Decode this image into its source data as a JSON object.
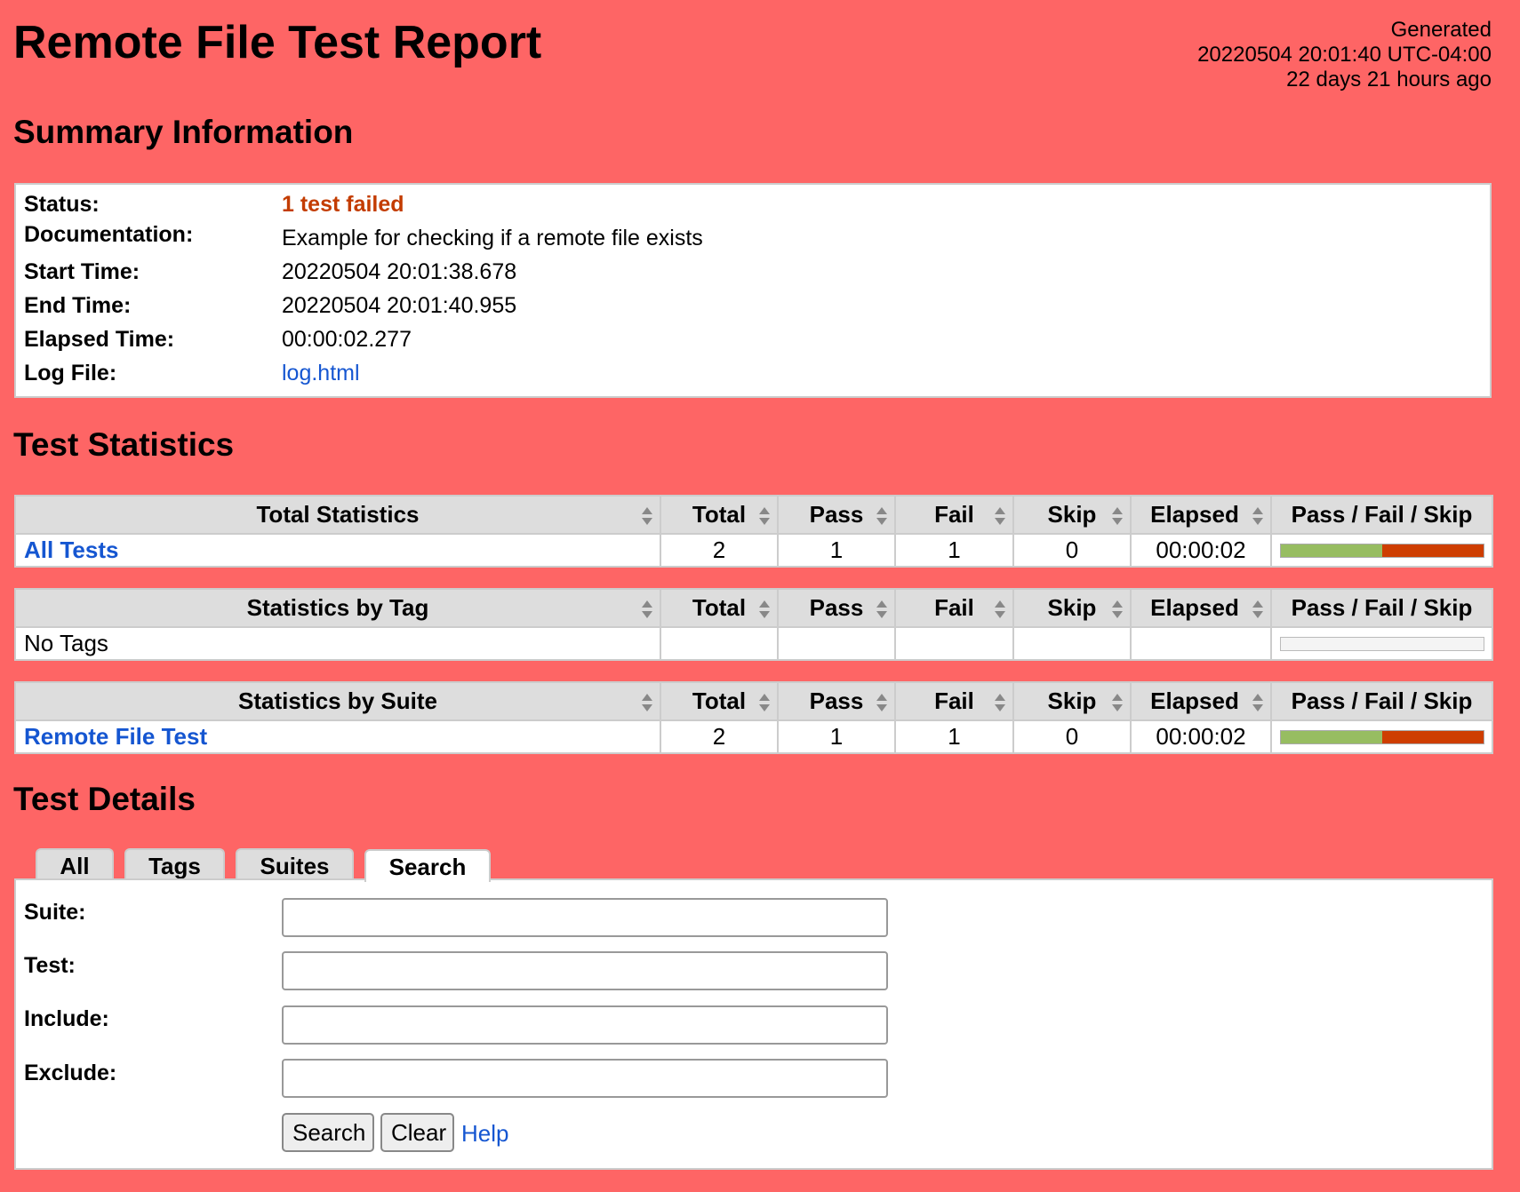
{
  "header": {
    "title": "Remote File Test Report",
    "generated_label": "Generated",
    "generated_time": "20220504 20:01:40 UTC-04:00",
    "generated_ago": "22 days 21 hours ago"
  },
  "summary": {
    "heading": "Summary Information",
    "status_label": "Status:",
    "status_value": "1 test failed",
    "documentation_label": "Documentation:",
    "documentation_value": "Example for checking if a remote file exists",
    "start_label": "Start Time:",
    "start_value": "20220504 20:01:38.678",
    "end_label": "End Time:",
    "end_value": "20220504 20:01:40.955",
    "elapsed_label": "Elapsed Time:",
    "elapsed_value": "00:00:02.277",
    "log_label": "Log File:",
    "log_value": "log.html"
  },
  "statistics": {
    "heading": "Test Statistics",
    "columns": {
      "total": "Total",
      "pass": "Pass",
      "fail": "Fail",
      "skip": "Skip",
      "elapsed": "Elapsed",
      "graph": "Pass / Fail / Skip"
    },
    "total": {
      "title": "Total Statistics",
      "row": {
        "name": "All Tests",
        "total": "2",
        "pass": "1",
        "fail": "1",
        "skip": "0",
        "elapsed": "00:00:02",
        "pass_pct": 50,
        "fail_pct": 50
      }
    },
    "tag": {
      "title": "Statistics by Tag",
      "row": {
        "name": "No Tags"
      }
    },
    "suite": {
      "title": "Statistics by Suite",
      "row": {
        "name": "Remote File Test",
        "total": "2",
        "pass": "1",
        "fail": "1",
        "skip": "0",
        "elapsed": "00:00:02",
        "pass_pct": 50,
        "fail_pct": 50
      }
    },
    "colors": {
      "pass": "#97bd61",
      "fail": "#ce3e01"
    }
  },
  "details": {
    "heading": "Test Details",
    "tabs": [
      "All",
      "Tags",
      "Suites",
      "Search"
    ],
    "active_tab": "Search",
    "fields": {
      "suite_label": "Suite:",
      "test_label": "Test:",
      "include_label": "Include:",
      "exclude_label": "Exclude:"
    },
    "search_button": "Search",
    "clear_button": "Clear",
    "help_link": "Help"
  },
  "theme": {
    "background": "#fe6565",
    "link": "#1556d1",
    "failed_text": "#c33c00"
  }
}
